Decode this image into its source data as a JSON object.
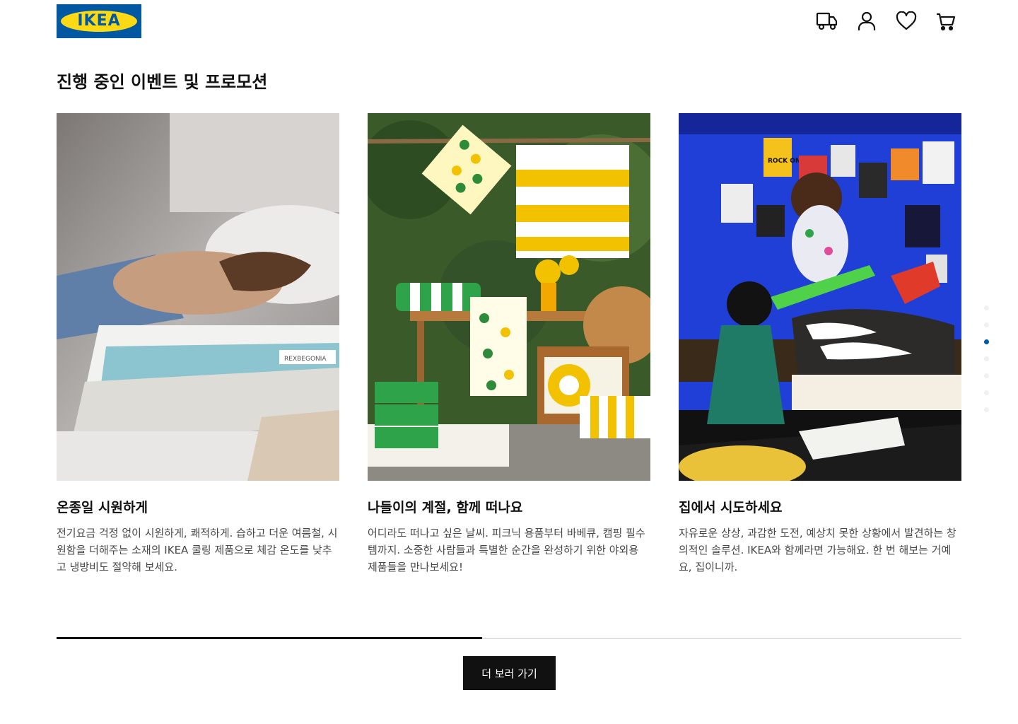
{
  "brand": {
    "logo_text": "IKEA",
    "blue": "#0058a3",
    "yellow": "#fbd914"
  },
  "header": {
    "icons": [
      "truck-icon",
      "user-icon",
      "heart-icon",
      "cart-icon"
    ]
  },
  "section": {
    "title": "진행 중인 이벤트 및 프로모션"
  },
  "cards": [
    {
      "title": "온종일 시원하게",
      "description": "전기요금 걱정 없이 시원하게, 쾌적하게. 습하고 더운 여름철, 시원함을 더해주는 소재의 IKEA 쿨링 제품으로 체감 온도를 낮추고 냉방비도 절약해 보세요.",
      "image_label": "REXBEGONIA"
    },
    {
      "title": "나들이의 계절, 함께 떠나요",
      "description": "어디라도 떠나고 싶은 날씨. 피크닉 용품부터 바베큐, 캠핑 필수템까지. 소중한 사람들과 특별한 순간을 완성하기 위한 야외용 제품들을 만나보세요!"
    },
    {
      "title": "집에서 시도하세요",
      "description": "자유로운 상상, 과감한 도전, 예상치 못한 상황에서 발견하는 창의적인 솔루션. IKEA와 함께라면 가능해요.  한 번 해보는 거예요, 집이니까.",
      "image_label": "ROCK ON"
    }
  ],
  "carousel": {
    "dot_count": 7,
    "active_dot": 2,
    "progress_fraction": 0.47
  },
  "cta": {
    "label": "더 보러 가기"
  }
}
